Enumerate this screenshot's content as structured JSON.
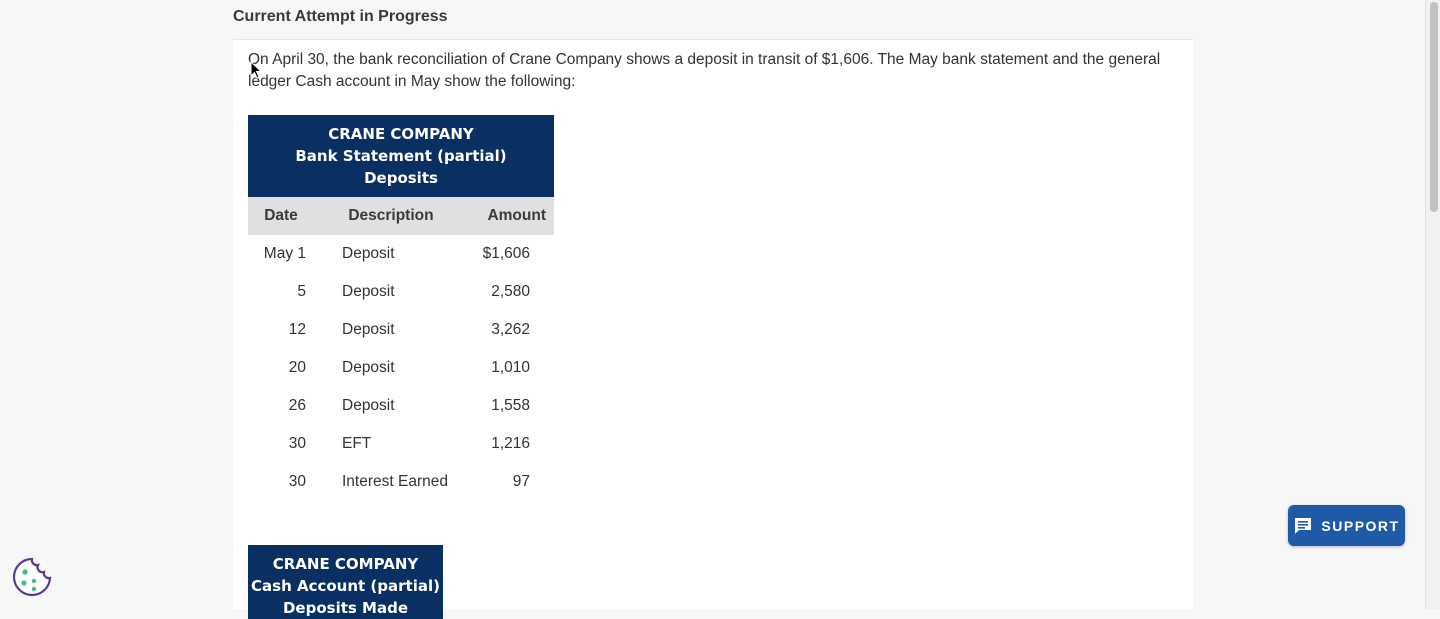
{
  "attempt": {
    "title": "Current Attempt in Progress"
  },
  "question": {
    "text": "On April 30, the bank reconciliation of Crane Company shows a deposit in transit of $1,606. The May bank statement and the general ledger Cash account in May show the following:"
  },
  "bank_statement": {
    "header_lines": [
      "CRANE COMPANY",
      "Bank Statement (partial)",
      "Deposits"
    ],
    "columns": [
      "Date",
      "Description",
      "Amount"
    ],
    "rows": [
      {
        "date": "May 1",
        "description": "Deposit",
        "amount": "$1,606"
      },
      {
        "date": "5",
        "description": "Deposit",
        "amount": "2,580"
      },
      {
        "date": "12",
        "description": "Deposit",
        "amount": "3,262"
      },
      {
        "date": "20",
        "description": "Deposit",
        "amount": "1,010"
      },
      {
        "date": "26",
        "description": "Deposit",
        "amount": "1,558"
      },
      {
        "date": "30",
        "description": "EFT",
        "amount": "1,216"
      },
      {
        "date": "30",
        "description": "Interest Earned",
        "amount": "97"
      }
    ]
  },
  "cash_account": {
    "header_lines": [
      "CRANE COMPANY",
      "Cash Account (partial)",
      "Deposits Made"
    ]
  },
  "support": {
    "label": "SUPPORT"
  },
  "colors": {
    "header_navy": "#0a2f62",
    "support_blue": "#1f5aa6",
    "cookie_green": "#3dbf7a"
  }
}
